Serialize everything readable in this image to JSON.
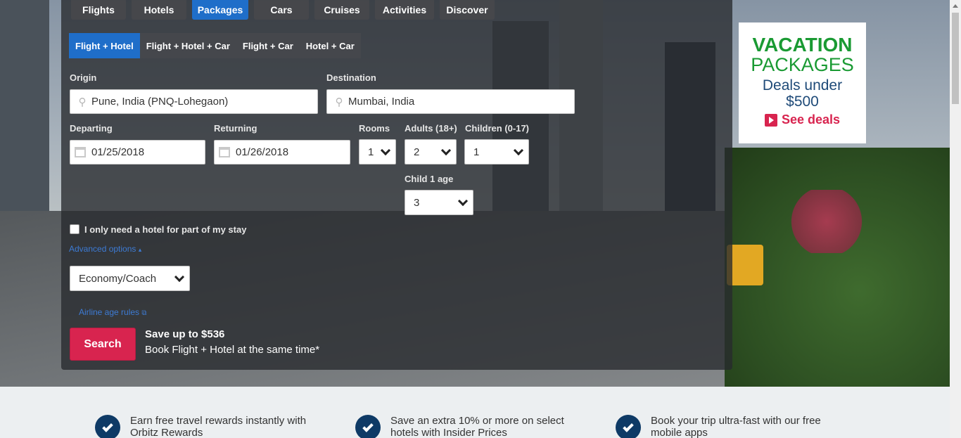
{
  "tabs": [
    {
      "label": "Flights"
    },
    {
      "label": "Hotels"
    },
    {
      "label": "Packages"
    },
    {
      "label": "Cars"
    },
    {
      "label": "Cruises"
    },
    {
      "label": "Activities"
    },
    {
      "label": "Discover"
    }
  ],
  "subtabs": [
    {
      "label": "Flight + Hotel"
    },
    {
      "label": "Flight + Hotel + Car"
    },
    {
      "label": "Flight + Car"
    },
    {
      "label": "Hotel + Car"
    }
  ],
  "form": {
    "origin_label": "Origin",
    "origin_value": "Pune, India (PNQ-Lohegaon)",
    "destination_label": "Destination",
    "destination_value": "Mumbai, India",
    "departing_label": "Departing",
    "departing_value": "01/25/2018",
    "returning_label": "Returning",
    "returning_value": "01/26/2018",
    "rooms_label": "Rooms",
    "rooms_value": "1",
    "adults_label": "Adults (18+)",
    "adults_value": "2",
    "children_label": "Children (0-17)",
    "children_value": "1",
    "child1_label": "Child 1 age",
    "child1_value": "3",
    "partial_stay_label": "I only need a hotel for part of my stay",
    "advanced_options_link": "Advanced options",
    "cabin_class_value": "Economy/Coach",
    "airline_age_rules_link": "Airline age rules",
    "search_button": "Search",
    "promo_headline": "Save up to $536",
    "promo_sub": "Book Flight + Hotel at the same time*"
  },
  "ad": {
    "line1": "VACATION",
    "line2": "PACKAGES",
    "line3": "Deals under",
    "line4": "$500",
    "cta": "See deals"
  },
  "benefits": [
    {
      "text": "Earn free travel rewards instantly with Orbitz Rewards"
    },
    {
      "text": "Save an extra 10% or more on select hotels with Insider Prices"
    },
    {
      "text": "Book your trip ultra-fast with our free mobile apps"
    }
  ],
  "colors": {
    "accent_blue": "#1f6ec9",
    "search_red": "#d8244f",
    "ad_green": "#1a9a33",
    "check_navy": "#0e3a66"
  }
}
